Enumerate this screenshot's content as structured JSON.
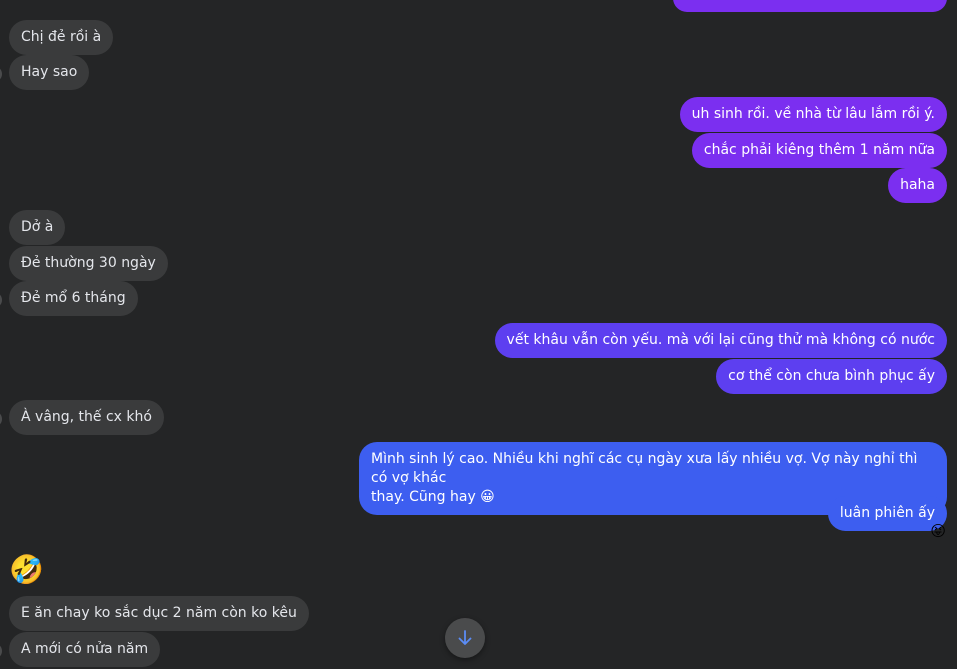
{
  "colors": {
    "background": "#242526",
    "incoming_bubble": "#3a3b3c",
    "incoming_text": "#e4e6eb",
    "outgoing_purple": "#7b2ff0",
    "outgoing_violet": "#5d3ff0",
    "outgoing_blue": "#3d5ef0",
    "scroll_button": "#4a4b4c"
  },
  "messages": {
    "m1": "Chị đẻ rồi à",
    "m2": "Hay sao",
    "m3": "uh sinh rồi. về nhà từ lâu lắm rồi ý.",
    "m4": "chắc phải kiêng thêm 1 năm nữa",
    "m5": "haha",
    "m6": "Dở à",
    "m7": "Đẻ thường 30 ngày",
    "m8": "Đẻ mổ 6 tháng",
    "m9": "vết khâu vẫn còn yếu. mà với lại cũng thử mà không có nước",
    "m10": "cơ thể còn chưa bình phục ấy",
    "m11": "À vâng, thế cx khó",
    "m12_line1": "Mình sinh lý cao. Nhiều khi nghĩ các cụ ngày xưa lấy nhiều vợ. Vợ này nghỉ thì có vợ khác",
    "m12_line2": "thay. Cũng hay 😀",
    "m13": "luân phiên ấy",
    "m13_reaction": "😝",
    "m14_emoji": "🤣",
    "m15": "E ăn chay ko sắc dục 2 năm còn ko kêu",
    "m16": "A mới có nửa năm"
  },
  "icons": {
    "scroll_down": "arrow-down-icon"
  }
}
